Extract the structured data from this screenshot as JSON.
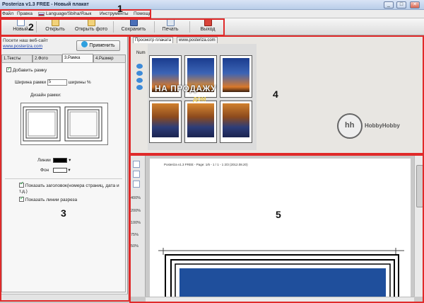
{
  "window": {
    "title": "Posteriza v1.3 FREE - Новый плакат",
    "controls": [
      "_",
      "□",
      "✕"
    ]
  },
  "menu": {
    "items": [
      "Файл",
      "Правка",
      "Language/Sbiha/Язык",
      "Инструменты",
      "Помощь"
    ]
  },
  "toolbar": {
    "buttons": [
      {
        "label": "Новый"
      },
      {
        "label": "Открыть"
      },
      {
        "label": "Открыть фото"
      },
      {
        "label": "Сохранить"
      },
      {
        "label": "Печать"
      },
      {
        "label": "Выход"
      }
    ]
  },
  "left": {
    "visit_text": "Посети наш веб-сайт",
    "visit_link": "www.posteriza.com",
    "apply_label": "Применить",
    "tabs": [
      "1.Тексты",
      "2.Фото",
      "3.Рамка",
      "4.Размер"
    ],
    "active_tab": 2,
    "add_frame_label": "Добавить рамку",
    "add_frame_checked": true,
    "frame_width_label": "Ширина рамки",
    "frame_width_value": "5",
    "frame_width_unit": "ширины %",
    "frame_design_label": "Дизайн рамки:",
    "lines_label": "Линии",
    "background_label": "Фон",
    "lines_color": "#000000",
    "background_color": "#ffffff",
    "show_header_label": "Показать заголовок(номера страниц, дата и т.д.)",
    "show_header_checked": true,
    "show_cut_lines_label": "Показать линии разреза",
    "show_cut_lines_checked": true
  },
  "preview": {
    "tabs": [
      "Просмотр плаката",
      "www.posteriza.com"
    ],
    "nav_label": "Num",
    "poster_text": "НА ПРОДАЖУ",
    "poster_sub": "ДОМ",
    "logo_text": "HobbyHobby",
    "grid": {
      "rows": 2,
      "cols": 3
    }
  },
  "pageview": {
    "zoom_levels": [
      "400%",
      "200%",
      "100%",
      "75%",
      "50%"
    ],
    "header_line": "Posteriza v1.3 FREE - Page: 1/6 - 1 / 1 - 1 2/3 (2012.08.20)"
  },
  "annotations": [
    "1",
    "2",
    "3",
    "4",
    "5"
  ],
  "colors": {
    "annotation": "#e02a2a",
    "accent": "#2fa0df"
  }
}
